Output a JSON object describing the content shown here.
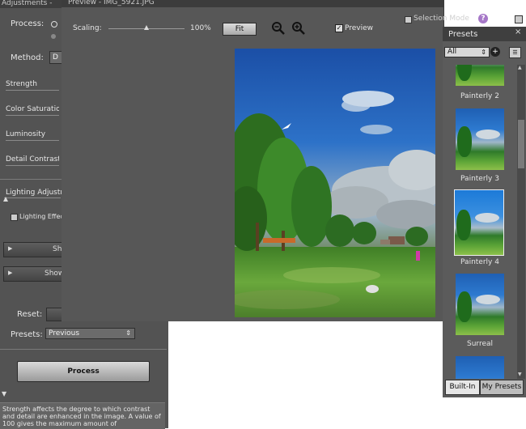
{
  "adjustments": {
    "title": "Adjustments -",
    "process_label": "Process:",
    "method_label": "Method:",
    "method_value": "D",
    "sliders": [
      "Strength",
      "Color Saturation",
      "Luminosity",
      "Detail Contrast"
    ],
    "lighting_label": "Lighting Adjustm",
    "lighting_effects": "Lighting Effec",
    "show_button_1": "Sh",
    "show_button_2": "Show",
    "reset_label": "Reset:",
    "presets_label": "Presets:",
    "presets_value": "Previous",
    "process_button": "Process",
    "help_text": "Strength affects the degree to which contrast and detail are enhanced in the image. A value of 100 gives the maximum amount of"
  },
  "preview": {
    "title": "Preview - IMG_5921.JPG",
    "scaling_label": "Scaling:",
    "scaling_value": "100%",
    "scaling_level": 0.5,
    "fit_button": "Fit",
    "preview_checkbox": "Preview",
    "preview_checked": true,
    "selection_mode": "Selection Mode",
    "help_icon": "question-icon"
  },
  "presets_panel": {
    "title": "Presets",
    "filter_value": "All",
    "items": [
      {
        "label": "Painterly 2",
        "selected": false
      },
      {
        "label": "Painterly 3",
        "selected": false
      },
      {
        "label": "Painterly 4",
        "selected": true
      },
      {
        "label": "Surreal",
        "selected": false
      }
    ],
    "tabs": [
      "Built-In",
      "My Presets"
    ],
    "active_tab": "Built-In"
  },
  "colors": {
    "panel": "#575757",
    "titlebar": "#3c3c3c",
    "sky": "#2d7ad0",
    "grass": "#5aa336"
  }
}
